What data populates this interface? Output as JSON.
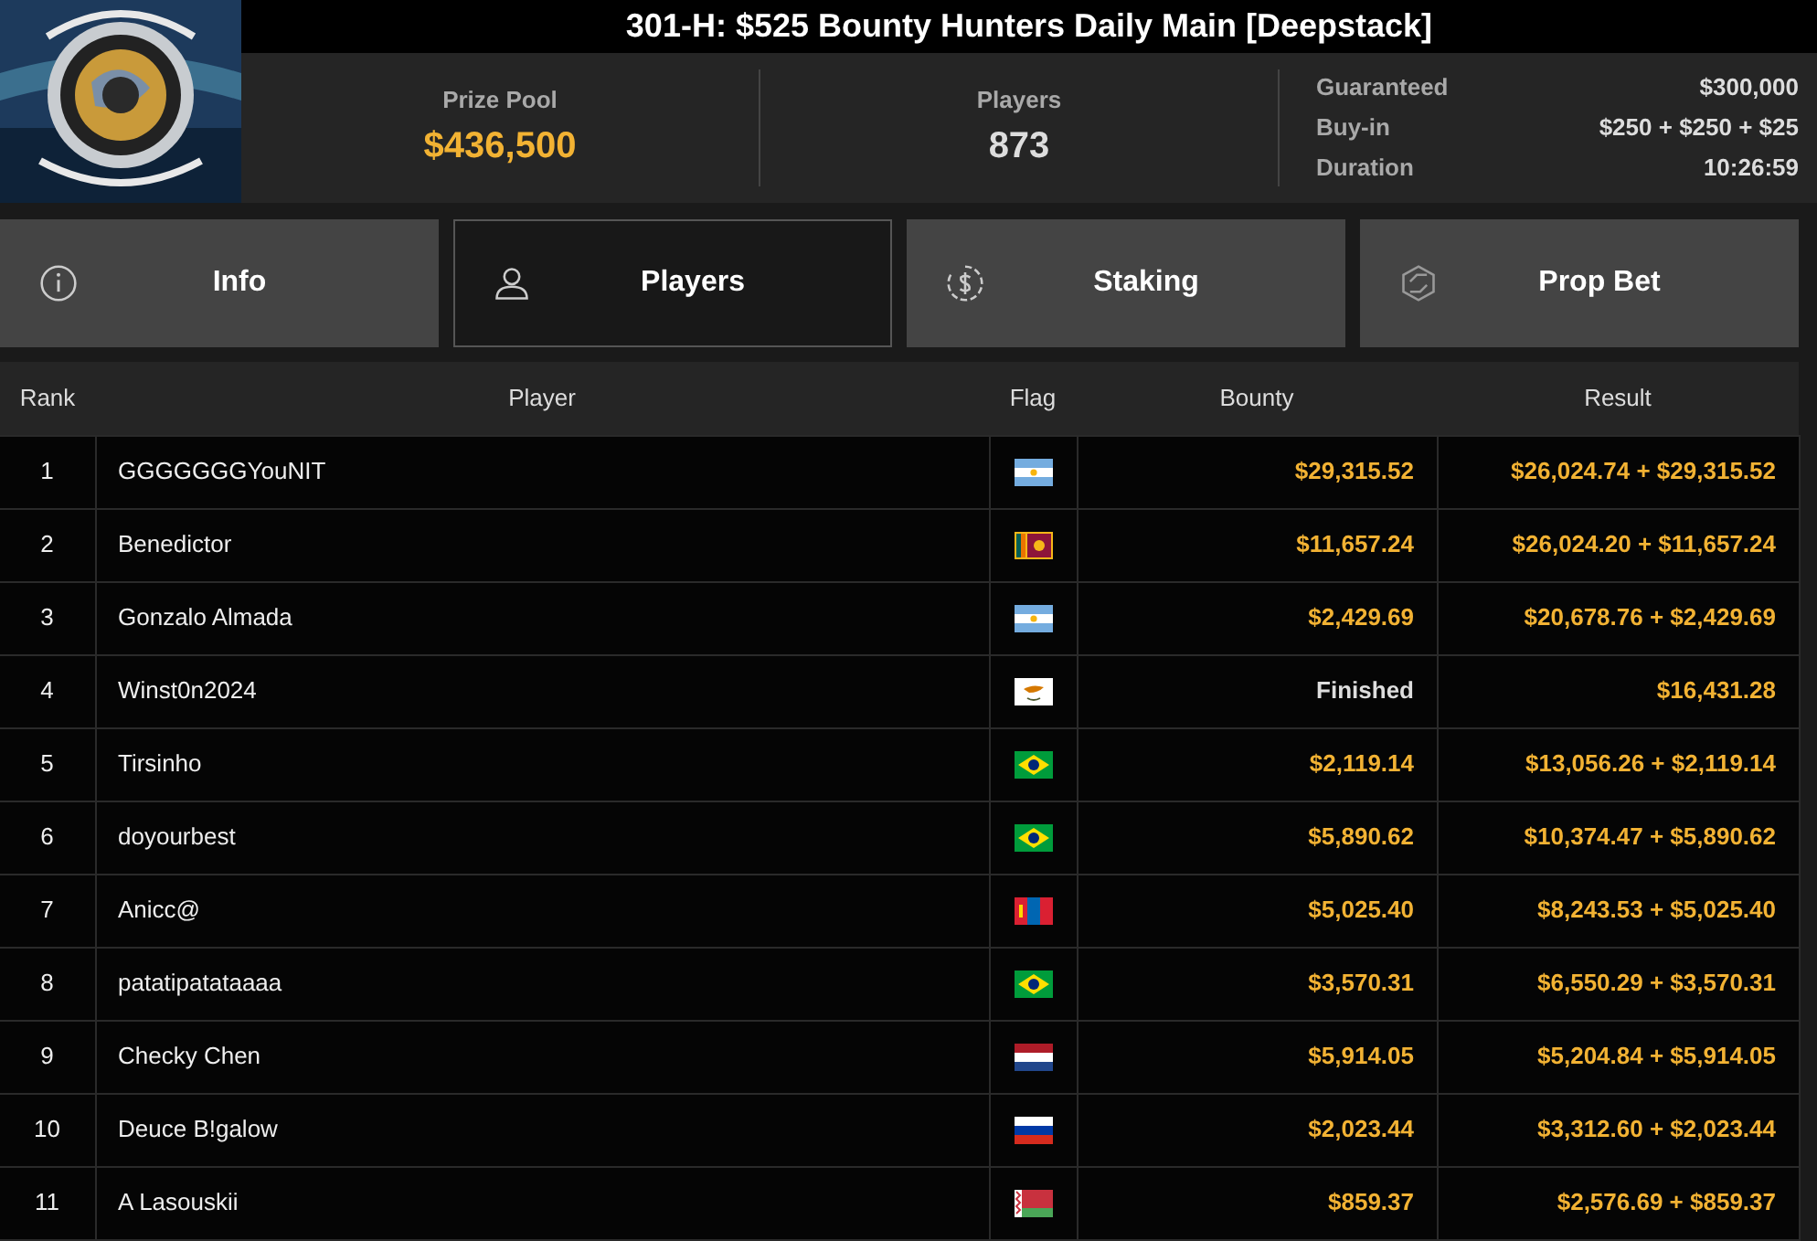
{
  "title": "301-H: $525 Bounty Hunters Daily Main [Deepstack]",
  "stats": [
    {
      "label": "Prize Pool",
      "value": "$436,500",
      "highlight": true
    },
    {
      "label": "Players",
      "value": "873",
      "highlight": false
    }
  ],
  "details": [
    {
      "label": "Guaranteed",
      "value": "$300,000"
    },
    {
      "label": "Buy-in",
      "value": "$250 + $250 + $25"
    },
    {
      "label": "Duration",
      "value": "10:26:59"
    }
  ],
  "tabs": [
    {
      "label": "Info",
      "kind": "info",
      "selected": false
    },
    {
      "label": "Players",
      "kind": "person",
      "selected": true
    },
    {
      "label": "Staking",
      "kind": "dollar",
      "selected": false
    },
    {
      "label": "Prop Bet",
      "kind": "hexagon",
      "selected": false
    }
  ],
  "table": {
    "columns": [
      "Rank",
      "Player",
      "Flag",
      "Bounty",
      "Result"
    ],
    "rows": [
      {
        "rank": "1",
        "player": "GGGGGGGYouNIT",
        "flag": {
          "kind": "argentina"
        },
        "bounty": "$29,315.52",
        "finished": false,
        "result": "$26,024.74 + $29,315.52"
      },
      {
        "rank": "2",
        "player": "Benedictor",
        "flag": {
          "kind": "srilanka"
        },
        "bounty": "$11,657.24",
        "finished": false,
        "result": "$26,024.20 + $11,657.24"
      },
      {
        "rank": "3",
        "player": "Gonzalo Almada",
        "flag": {
          "kind": "argentina"
        },
        "bounty": "$2,429.69",
        "finished": false,
        "result": "$20,678.76 + $2,429.69"
      },
      {
        "rank": "4",
        "player": "Winst0n2024",
        "flag": {
          "kind": "cyprus"
        },
        "bounty": "Finished",
        "finished": true,
        "result": "$16,431.28"
      },
      {
        "rank": "5",
        "player": "Tirsinho",
        "flag": {
          "kind": "brazil"
        },
        "bounty": "$2,119.14",
        "finished": false,
        "result": "$13,056.26 + $2,119.14"
      },
      {
        "rank": "6",
        "player": "doyourbest",
        "flag": {
          "kind": "brazil"
        },
        "bounty": "$5,890.62",
        "finished": false,
        "result": "$10,374.47 + $5,890.62"
      },
      {
        "rank": "7",
        "player": "Anicc@",
        "flag": {
          "kind": "mongolia"
        },
        "bounty": "$5,025.40",
        "finished": false,
        "result": "$8,243.53 + $5,025.40"
      },
      {
        "rank": "8",
        "player": "patatipatataaaa",
        "flag": {
          "kind": "brazil"
        },
        "bounty": "$3,570.31",
        "finished": false,
        "result": "$6,550.29 + $3,570.31"
      },
      {
        "rank": "9",
        "player": "Checky Chen",
        "flag": {
          "kind": "netherlands"
        },
        "bounty": "$5,914.05",
        "finished": false,
        "result": "$5,204.84 + $5,914.05"
      },
      {
        "rank": "10",
        "player": "Deuce B!galow",
        "flag": {
          "kind": "russia"
        },
        "bounty": "$2,023.44",
        "finished": false,
        "result": "$3,312.60 + $2,023.44"
      },
      {
        "rank": "11",
        "player": "A Lasouskii",
        "flag": {
          "kind": "belarus"
        },
        "bounty": "$859.37",
        "finished": false,
        "result": "$2,576.69 + $859.37"
      }
    ]
  }
}
